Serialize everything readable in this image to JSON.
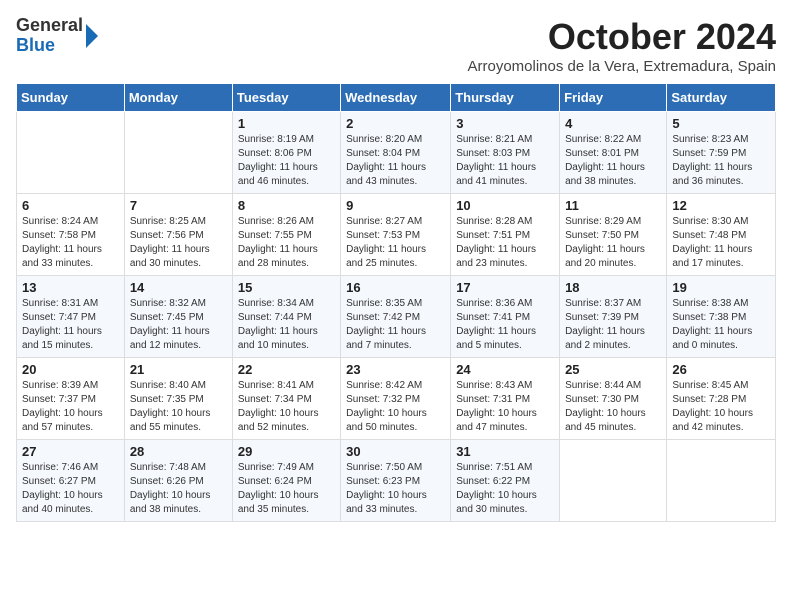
{
  "logo": {
    "general": "General",
    "blue": "Blue"
  },
  "header": {
    "month": "October 2024",
    "location": "Arroyomolinos de la Vera, Extremadura, Spain"
  },
  "weekdays": [
    "Sunday",
    "Monday",
    "Tuesday",
    "Wednesday",
    "Thursday",
    "Friday",
    "Saturday"
  ],
  "weeks": [
    [
      {
        "day": "",
        "info": ""
      },
      {
        "day": "",
        "info": ""
      },
      {
        "day": "1",
        "info": "Sunrise: 8:19 AM\nSunset: 8:06 PM\nDaylight: 11 hours and 46 minutes."
      },
      {
        "day": "2",
        "info": "Sunrise: 8:20 AM\nSunset: 8:04 PM\nDaylight: 11 hours and 43 minutes."
      },
      {
        "day": "3",
        "info": "Sunrise: 8:21 AM\nSunset: 8:03 PM\nDaylight: 11 hours and 41 minutes."
      },
      {
        "day": "4",
        "info": "Sunrise: 8:22 AM\nSunset: 8:01 PM\nDaylight: 11 hours and 38 minutes."
      },
      {
        "day": "5",
        "info": "Sunrise: 8:23 AM\nSunset: 7:59 PM\nDaylight: 11 hours and 36 minutes."
      }
    ],
    [
      {
        "day": "6",
        "info": "Sunrise: 8:24 AM\nSunset: 7:58 PM\nDaylight: 11 hours and 33 minutes."
      },
      {
        "day": "7",
        "info": "Sunrise: 8:25 AM\nSunset: 7:56 PM\nDaylight: 11 hours and 30 minutes."
      },
      {
        "day": "8",
        "info": "Sunrise: 8:26 AM\nSunset: 7:55 PM\nDaylight: 11 hours and 28 minutes."
      },
      {
        "day": "9",
        "info": "Sunrise: 8:27 AM\nSunset: 7:53 PM\nDaylight: 11 hours and 25 minutes."
      },
      {
        "day": "10",
        "info": "Sunrise: 8:28 AM\nSunset: 7:51 PM\nDaylight: 11 hours and 23 minutes."
      },
      {
        "day": "11",
        "info": "Sunrise: 8:29 AM\nSunset: 7:50 PM\nDaylight: 11 hours and 20 minutes."
      },
      {
        "day": "12",
        "info": "Sunrise: 8:30 AM\nSunset: 7:48 PM\nDaylight: 11 hours and 17 minutes."
      }
    ],
    [
      {
        "day": "13",
        "info": "Sunrise: 8:31 AM\nSunset: 7:47 PM\nDaylight: 11 hours and 15 minutes."
      },
      {
        "day": "14",
        "info": "Sunrise: 8:32 AM\nSunset: 7:45 PM\nDaylight: 11 hours and 12 minutes."
      },
      {
        "day": "15",
        "info": "Sunrise: 8:34 AM\nSunset: 7:44 PM\nDaylight: 11 hours and 10 minutes."
      },
      {
        "day": "16",
        "info": "Sunrise: 8:35 AM\nSunset: 7:42 PM\nDaylight: 11 hours and 7 minutes."
      },
      {
        "day": "17",
        "info": "Sunrise: 8:36 AM\nSunset: 7:41 PM\nDaylight: 11 hours and 5 minutes."
      },
      {
        "day": "18",
        "info": "Sunrise: 8:37 AM\nSunset: 7:39 PM\nDaylight: 11 hours and 2 minutes."
      },
      {
        "day": "19",
        "info": "Sunrise: 8:38 AM\nSunset: 7:38 PM\nDaylight: 11 hours and 0 minutes."
      }
    ],
    [
      {
        "day": "20",
        "info": "Sunrise: 8:39 AM\nSunset: 7:37 PM\nDaylight: 10 hours and 57 minutes."
      },
      {
        "day": "21",
        "info": "Sunrise: 8:40 AM\nSunset: 7:35 PM\nDaylight: 10 hours and 55 minutes."
      },
      {
        "day": "22",
        "info": "Sunrise: 8:41 AM\nSunset: 7:34 PM\nDaylight: 10 hours and 52 minutes."
      },
      {
        "day": "23",
        "info": "Sunrise: 8:42 AM\nSunset: 7:32 PM\nDaylight: 10 hours and 50 minutes."
      },
      {
        "day": "24",
        "info": "Sunrise: 8:43 AM\nSunset: 7:31 PM\nDaylight: 10 hours and 47 minutes."
      },
      {
        "day": "25",
        "info": "Sunrise: 8:44 AM\nSunset: 7:30 PM\nDaylight: 10 hours and 45 minutes."
      },
      {
        "day": "26",
        "info": "Sunrise: 8:45 AM\nSunset: 7:28 PM\nDaylight: 10 hours and 42 minutes."
      }
    ],
    [
      {
        "day": "27",
        "info": "Sunrise: 7:46 AM\nSunset: 6:27 PM\nDaylight: 10 hours and 40 minutes."
      },
      {
        "day": "28",
        "info": "Sunrise: 7:48 AM\nSunset: 6:26 PM\nDaylight: 10 hours and 38 minutes."
      },
      {
        "day": "29",
        "info": "Sunrise: 7:49 AM\nSunset: 6:24 PM\nDaylight: 10 hours and 35 minutes."
      },
      {
        "day": "30",
        "info": "Sunrise: 7:50 AM\nSunset: 6:23 PM\nDaylight: 10 hours and 33 minutes."
      },
      {
        "day": "31",
        "info": "Sunrise: 7:51 AM\nSunset: 6:22 PM\nDaylight: 10 hours and 30 minutes."
      },
      {
        "day": "",
        "info": ""
      },
      {
        "day": "",
        "info": ""
      }
    ]
  ]
}
